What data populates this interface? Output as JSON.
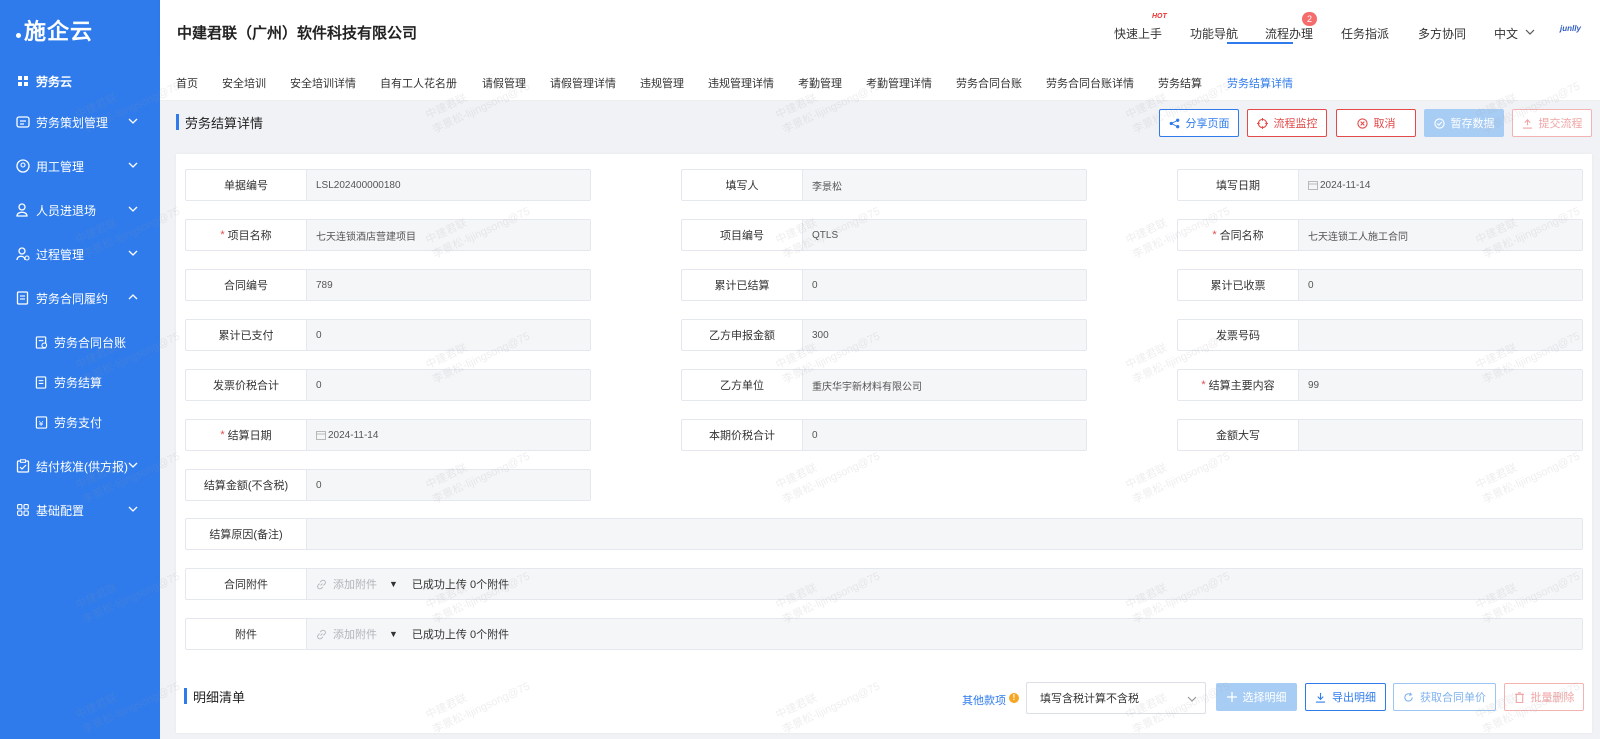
{
  "app": {
    "logo_text": "施企云",
    "company": "中建君联（广州）软件科技有限公司",
    "brand": "junlly"
  },
  "header": {
    "menu": [
      "快速上手",
      "功能导航",
      "流程办理",
      "任务指派",
      "多方协同",
      "中文"
    ],
    "hot_label": "HOT",
    "badge_count": "2"
  },
  "sidebar": {
    "items": [
      {
        "label": "劳务云",
        "icon": "grid-icon"
      },
      {
        "label": "劳务策划管理",
        "icon": "folder-icon"
      },
      {
        "label": "用工管理",
        "icon": "worker-icon"
      },
      {
        "label": "人员进退场",
        "icon": "user-icon"
      },
      {
        "label": "过程管理",
        "icon": "user-gear-icon"
      },
      {
        "label": "劳务合同履约",
        "icon": "contract-icon"
      },
      {
        "label": "劳务合同台账",
        "icon": "ledger-icon"
      },
      {
        "label": "劳务结算",
        "icon": "settle-icon"
      },
      {
        "label": "劳务支付",
        "icon": "pay-icon"
      },
      {
        "label": "结付核准(供方报)",
        "icon": "clipboard-icon"
      },
      {
        "label": "基础配置",
        "icon": "apps-icon"
      }
    ]
  },
  "tabs": [
    "首页",
    "安全培训",
    "安全培训详情",
    "自有工人花名册",
    "请假管理",
    "请假管理详情",
    "违规管理",
    "违规管理详情",
    "考勤管理",
    "考勤管理详情",
    "劳务合同台账",
    "劳务合同台账详情",
    "劳务结算",
    "劳务结算详情"
  ],
  "page": {
    "title": "劳务结算详情",
    "actions": {
      "share": "分享页面",
      "monitor": "流程监控",
      "cancel": "取消",
      "save": "暂存数据",
      "submit": "提交流程"
    }
  },
  "form": {
    "doc_no": {
      "label": "单据编号",
      "value": "LSL202400000180"
    },
    "filler": {
      "label": "填写人",
      "value": "李景松"
    },
    "fill_date": {
      "label": "填写日期",
      "value": "2024-11-14"
    },
    "project_name": {
      "label": "项目名称",
      "value": "七天连锁酒店营建项目"
    },
    "project_no": {
      "label": "项目编号",
      "value": "QTLS"
    },
    "contract_name": {
      "label": "合同名称",
      "value": "七天连锁工人施工合同"
    },
    "contract_no": {
      "label": "合同编号",
      "value": "789"
    },
    "total_settled": {
      "label": "累计已结算",
      "value": "0"
    },
    "total_received": {
      "label": "累计已收票",
      "value": "0"
    },
    "total_paid": {
      "label": "累计已支付",
      "value": "0"
    },
    "party_b_amount": {
      "label": "乙方申报金额",
      "value": "300"
    },
    "invoice_no": {
      "label": "发票号码",
      "value": ""
    },
    "invoice_total": {
      "label": "发票价税合计",
      "value": "0"
    },
    "party_b_unit": {
      "label": "乙方单位",
      "value": "重庆华宇新材料有限公司"
    },
    "settle_content": {
      "label": "结算主要内容",
      "value": "99"
    },
    "settle_date": {
      "label": "结算日期",
      "value": "2024-11-14"
    },
    "period_total": {
      "label": "本期价税合计",
      "value": "0"
    },
    "amount_upper": {
      "label": "金额大写",
      "value": ""
    },
    "settle_amount": {
      "label": "结算金额(不含税)",
      "value": "0"
    },
    "reason": {
      "label": "结算原因(备注)",
      "value": ""
    },
    "contract_attach": {
      "label": "合同附件",
      "add": "添加附件",
      "status": "已成功上传 0个附件"
    },
    "attach": {
      "label": "附件",
      "add": "添加附件",
      "status": "已成功上传 0个附件"
    }
  },
  "detail": {
    "title": "明细清单",
    "other_fees": "其他款项",
    "select_value": "填写含税计算不含税",
    "btn_choose": "选择明细",
    "btn_export": "导出明细",
    "btn_fetch": "获取合同单价",
    "btn_delete": "批量删除"
  },
  "watermark": {
    "line1": "中建君联",
    "line2": "李景松-lijingsong@75"
  },
  "colors": {
    "primary": "#2f7bec",
    "danger": "#e34a4a",
    "required": "#e34a4a"
  }
}
